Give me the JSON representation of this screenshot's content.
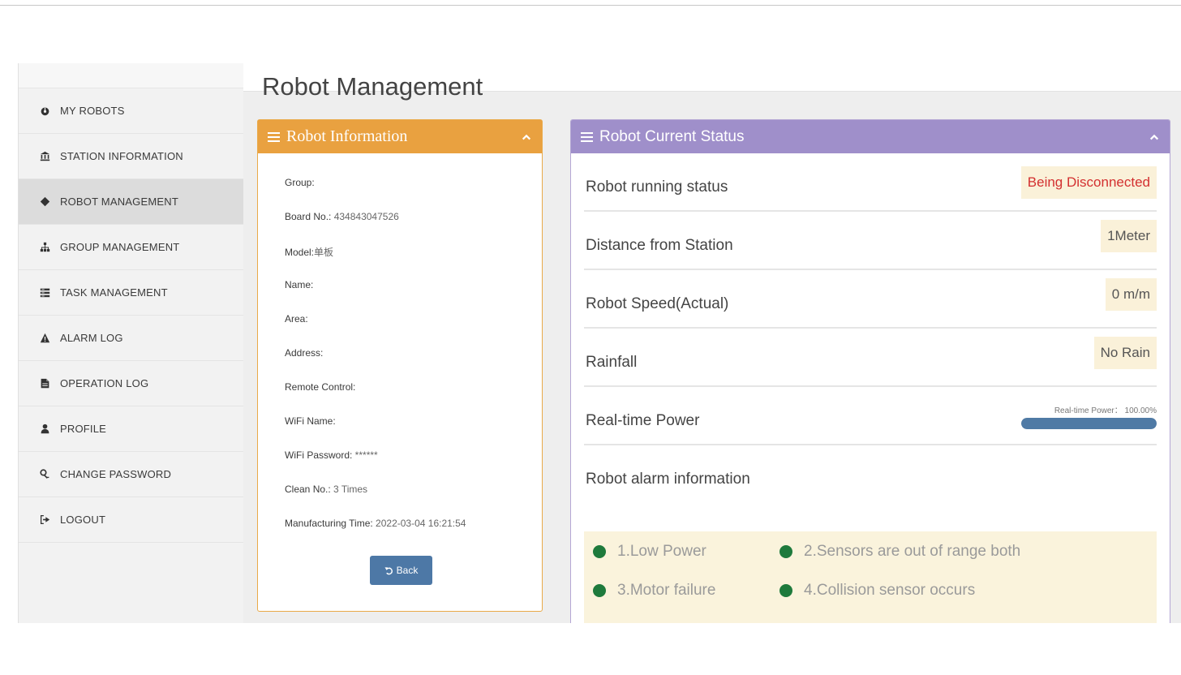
{
  "page": {
    "title": "Robot Management"
  },
  "sidebar": {
    "items": [
      {
        "label": "MY ROBOTS",
        "icon": "dashboard-icon"
      },
      {
        "label": "STATION INFORMATION",
        "icon": "bank-icon"
      },
      {
        "label": "ROBOT MANAGEMENT",
        "icon": "robot-icon",
        "active": true
      },
      {
        "label": "GROUP MANAGEMENT",
        "icon": "sitemap-icon"
      },
      {
        "label": "TASK MANAGEMENT",
        "icon": "tasks-icon"
      },
      {
        "label": "ALARM LOG",
        "icon": "warning-icon"
      },
      {
        "label": "OPERATION LOG",
        "icon": "file-icon"
      },
      {
        "label": "PROFILE",
        "icon": "user-icon"
      },
      {
        "label": "CHANGE PASSWORD",
        "icon": "key-icon"
      },
      {
        "label": "LOGOUT",
        "icon": "logout-icon"
      }
    ]
  },
  "info_panel": {
    "title": "Robot Information",
    "fields": [
      {
        "label": "Group:",
        "value": ""
      },
      {
        "label": "Board No.:",
        "value": " 434843047526"
      },
      {
        "label": "Model:",
        "value": "单板"
      },
      {
        "label": "Name:",
        "value": ""
      },
      {
        "label": "Area:",
        "value": ""
      },
      {
        "label": "Address:",
        "value": ""
      },
      {
        "label": "Remote Control:",
        "value": ""
      },
      {
        "label": "WiFi Name:",
        "value": ""
      },
      {
        "label": "WiFi Password:",
        "value": " ******"
      },
      {
        "label": "Clean No.:",
        "value": " 3  Times"
      },
      {
        "label": "Manufacturing Time:",
        "value": " 2022-03-04 16:21:54"
      }
    ],
    "back_label": "Back"
  },
  "status_panel": {
    "title": "Robot Current Status",
    "rows": [
      {
        "label": "Robot running status",
        "value": "Being Disconnected",
        "color": "#d33030"
      },
      {
        "label": "Distance from Station",
        "value": "1Meter"
      },
      {
        "label": "Robot Speed(Actual)",
        "value": "0 m/m"
      },
      {
        "label": "Rainfall",
        "value": "No Rain"
      }
    ],
    "power": {
      "label": "Real-time Power",
      "text": "Real-time Power： 100.00%",
      "fraction": 1.0
    },
    "alarm_label": "Robot alarm information",
    "alarms": [
      "1.Low Power",
      "2.Sensors are out of range both",
      "3.Motor failure",
      "4.Collision sensor occurs"
    ],
    "alarm_dot_color": "#1e7a3c"
  }
}
